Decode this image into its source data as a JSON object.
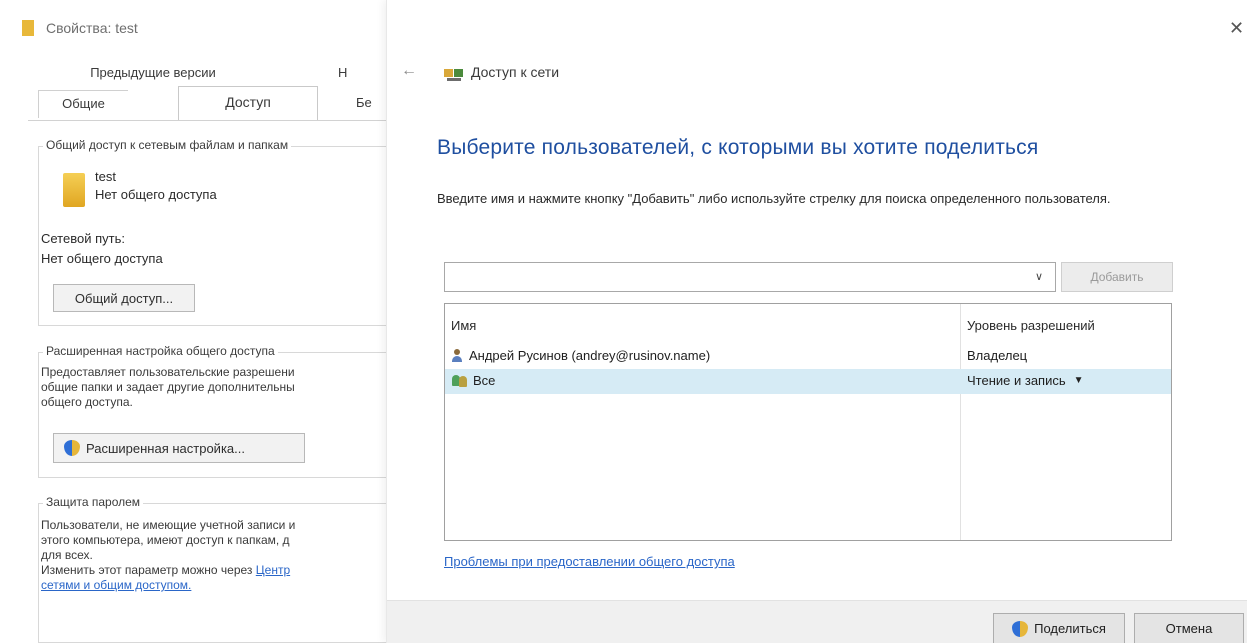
{
  "props_dialog": {
    "title": "Свойства: test",
    "tabs": {
      "previous_versions": "Предыдущие версии",
      "fragment_n": "Н",
      "general": "Общие",
      "access": "Доступ",
      "fragment_b": "Бе"
    },
    "group_network": {
      "legend": "Общий доступ к сетевым файлам и папкам",
      "folder_name": "test",
      "folder_status": "Нет общего доступа",
      "path_label": "Сетевой путь:",
      "path_value": "Нет общего доступа",
      "share_button": "Общий доступ..."
    },
    "group_advanced": {
      "legend": "Расширенная настройка общего доступа",
      "line1": "Предоставляет пользовательские разрешени",
      "line2": "общие папки и задает другие дополнительны",
      "line3": "общего доступа.",
      "button": "Расширенная настройка..."
    },
    "group_password": {
      "legend": "Защита паролем",
      "line1": "Пользователи, не имеющие учетной записи и",
      "line2": "этого компьютера, имеют доступ к папкам, д",
      "line3": "для всех.",
      "line4_text": "Изменить этот параметр можно через ",
      "line4_link": "Центр",
      "line5_link": "сетями и общим доступом."
    }
  },
  "wizard": {
    "title": "Доступ к сети",
    "heading": "Выберите пользователей, с которыми вы хотите поделиться",
    "instruction": "Введите имя и нажмите кнопку \"Добавить\" либо используйте стрелку для поиска определенного пользователя.",
    "input_value": "",
    "add_button": "Добавить",
    "table": {
      "headers": [
        "Имя",
        "Уровень разрешений"
      ],
      "rows": [
        {
          "name": "Андрей Русинов (andrey@rusinov.name)",
          "permission": "Владелец"
        },
        {
          "name": "Все",
          "permission": "Чтение и запись"
        }
      ]
    },
    "trouble_link": "Проблемы при предоставлении общего доступа",
    "share_button": "Поделиться",
    "cancel_button": "Отмена",
    "close_glyph": "✕",
    "back_glyph": "←",
    "combo_arrow_glyph": "∨",
    "dropdown_glyph": "▼"
  },
  "icons": {
    "folder": "folder-icon",
    "shield": "shield-icon",
    "user": "user-icon",
    "group": "group-icon",
    "network": "network-share-icon"
  },
  "colors": {
    "heading_blue": "#1f4fa0",
    "link_blue": "#2a66c8",
    "selection": "#d6ebf5",
    "folder_yellow": "#e8b83a"
  }
}
